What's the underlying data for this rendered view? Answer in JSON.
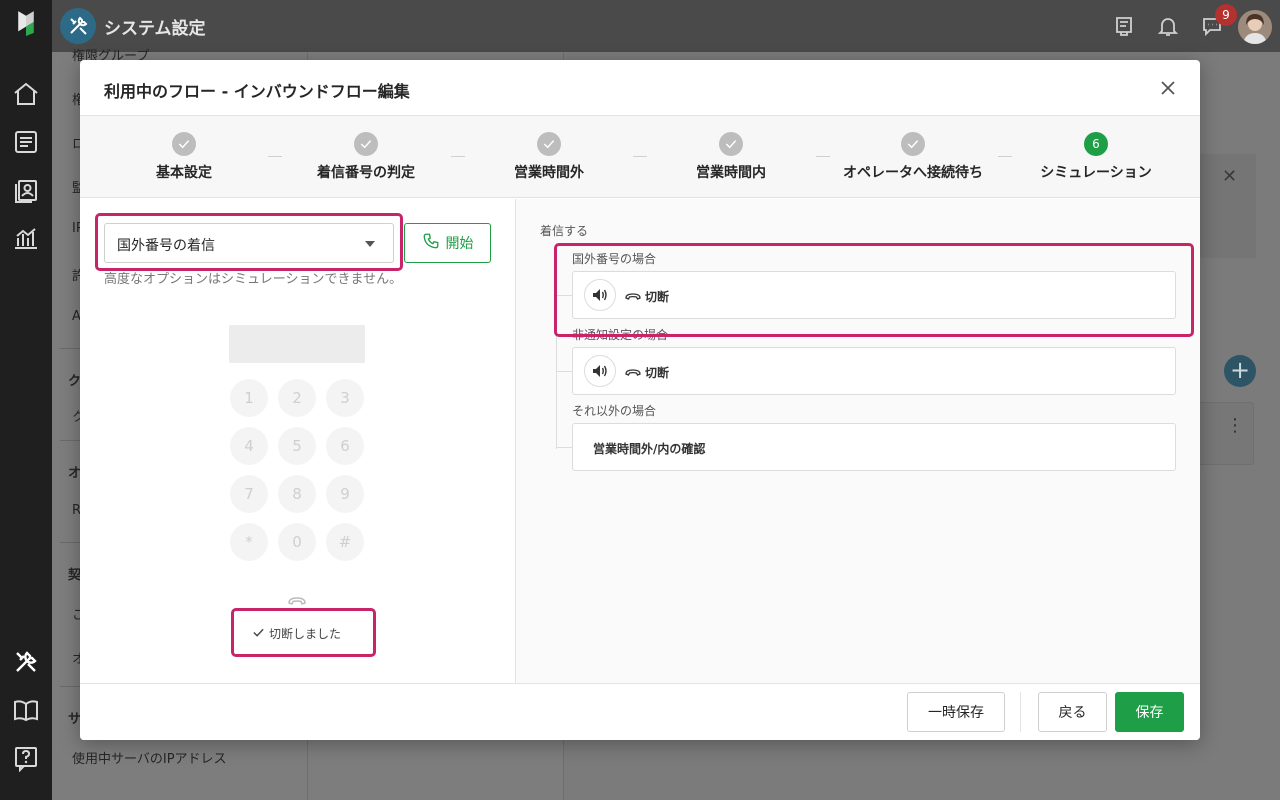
{
  "app": {
    "title": "システム設定",
    "notification_count": "9"
  },
  "bg_menu": {
    "items": [
      "権限グループ",
      "権",
      "ロ",
      "監",
      "IP",
      "許",
      "A",
      "ク",
      "オ",
      "R",
      "契",
      "こ",
      "オ",
      "サ",
      "使用中サーバのIPアドレス"
    ]
  },
  "modal": {
    "title": "利用中のフロー - インバウンドフロー編集",
    "steps": [
      {
        "label": "基本設定",
        "state": "done"
      },
      {
        "label": "着信番号の判定",
        "state": "done"
      },
      {
        "label": "営業時間外",
        "state": "done"
      },
      {
        "label": "営業時間内",
        "state": "done"
      },
      {
        "label": "オペレータへ接続待ち",
        "state": "done"
      },
      {
        "label": "シミュレーション",
        "state": "active",
        "number": "6"
      }
    ],
    "sim": {
      "select_value": "国外番号の着信",
      "start_label": "開始",
      "note": "高度なオプションはシミュレーションできません。",
      "keypad": [
        "1",
        "2",
        "3",
        "4",
        "5",
        "6",
        "7",
        "8",
        "9",
        "*",
        "0",
        "#"
      ],
      "status": "切断しました"
    },
    "flow": {
      "root": "着信する",
      "cases": [
        {
          "label": "国外番号の場合",
          "action": "切断",
          "has_sound": true
        },
        {
          "label": "非通知設定の場合",
          "action": "切断",
          "has_sound": true
        },
        {
          "label": "それ以外の場合",
          "action": "営業時間外/内の確認",
          "has_sound": false
        }
      ]
    },
    "footer": {
      "temp_save": "一時保存",
      "back": "戻る",
      "save": "保存"
    }
  },
  "colors": {
    "accent": "#1e9e46",
    "highlight": "#c7246a",
    "badge": "#b3322f"
  }
}
